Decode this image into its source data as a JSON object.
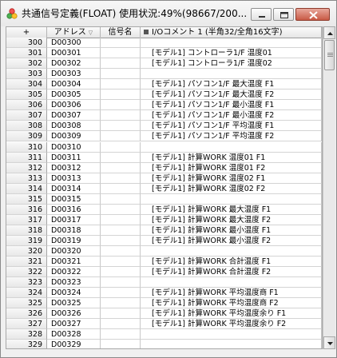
{
  "window": {
    "title": "共通信号定義(FLOAT) 使用状況:49%(98667/200..."
  },
  "colors": {
    "close_button": "#c85a45",
    "header_bg": "#e6e6e6",
    "row_header_bg": "#ececec"
  },
  "table": {
    "columns": [
      "+",
      "アドレス",
      "信号名",
      "I/Oコメント 1 (半角32/全角16文字)"
    ],
    "rows": [
      {
        "no": "300",
        "address": "D00300",
        "name": "",
        "comment": ""
      },
      {
        "no": "301",
        "address": "D00301",
        "name": "",
        "comment": "[モデル1] コントローラ1/F 温度01"
      },
      {
        "no": "302",
        "address": "D00302",
        "name": "",
        "comment": "[モデル1] コントローラ1/F 温度02"
      },
      {
        "no": "303",
        "address": "D00303",
        "name": "",
        "comment": ""
      },
      {
        "no": "304",
        "address": "D00304",
        "name": "",
        "comment": "[モデル1] パソコン1/F 最大温度 F1"
      },
      {
        "no": "305",
        "address": "D00305",
        "name": "",
        "comment": "[モデル1] パソコン1/F 最大温度 F2"
      },
      {
        "no": "306",
        "address": "D00306",
        "name": "",
        "comment": "[モデル1] パソコン1/F 最小温度 F1"
      },
      {
        "no": "307",
        "address": "D00307",
        "name": "",
        "comment": "[モデル1] パソコン1/F 最小温度 F2"
      },
      {
        "no": "308",
        "address": "D00308",
        "name": "",
        "comment": "[モデル1] パソコン1/F 平均温度 F1"
      },
      {
        "no": "309",
        "address": "D00309",
        "name": "",
        "comment": "[モデル1] パソコン1/F 平均温度 F2"
      },
      {
        "no": "310",
        "address": "D00310",
        "name": "",
        "comment": ""
      },
      {
        "no": "311",
        "address": "D00311",
        "name": "",
        "comment": "[モデル1] 計算WORK 温度01 F1"
      },
      {
        "no": "312",
        "address": "D00312",
        "name": "",
        "comment": "[モデル1] 計算WORK 温度01 F2"
      },
      {
        "no": "313",
        "address": "D00313",
        "name": "",
        "comment": "[モデル1] 計算WORK 温度02 F1"
      },
      {
        "no": "314",
        "address": "D00314",
        "name": "",
        "comment": "[モデル1] 計算WORK 温度02 F2"
      },
      {
        "no": "315",
        "address": "D00315",
        "name": "",
        "comment": ""
      },
      {
        "no": "316",
        "address": "D00316",
        "name": "",
        "comment": "[モデル1] 計算WORK 最大温度 F1"
      },
      {
        "no": "317",
        "address": "D00317",
        "name": "",
        "comment": "[モデル1] 計算WORK 最大温度 F2"
      },
      {
        "no": "318",
        "address": "D00318",
        "name": "",
        "comment": "[モデル1] 計算WORK 最小温度 F1"
      },
      {
        "no": "319",
        "address": "D00319",
        "name": "",
        "comment": "[モデル1] 計算WORK 最小温度 F2"
      },
      {
        "no": "320",
        "address": "D00320",
        "name": "",
        "comment": ""
      },
      {
        "no": "321",
        "address": "D00321",
        "name": "",
        "comment": "[モデル1] 計算WORK 合計温度 F1"
      },
      {
        "no": "322",
        "address": "D00322",
        "name": "",
        "comment": "[モデル1] 計算WORK 合計温度 F2"
      },
      {
        "no": "323",
        "address": "D00323",
        "name": "",
        "comment": ""
      },
      {
        "no": "324",
        "address": "D00324",
        "name": "",
        "comment": "[モデル1] 計算WORK 平均温度商 F1"
      },
      {
        "no": "325",
        "address": "D00325",
        "name": "",
        "comment": "[モデル1] 計算WORK 平均温度商 F2"
      },
      {
        "no": "326",
        "address": "D00326",
        "name": "",
        "comment": "[モデル1] 計算WORK 平均温度余り F1"
      },
      {
        "no": "327",
        "address": "D00327",
        "name": "",
        "comment": "[モデル1] 計算WORK 平均温度余り F2"
      },
      {
        "no": "328",
        "address": "D00328",
        "name": "",
        "comment": ""
      },
      {
        "no": "329",
        "address": "D00329",
        "name": "",
        "comment": ""
      }
    ]
  }
}
